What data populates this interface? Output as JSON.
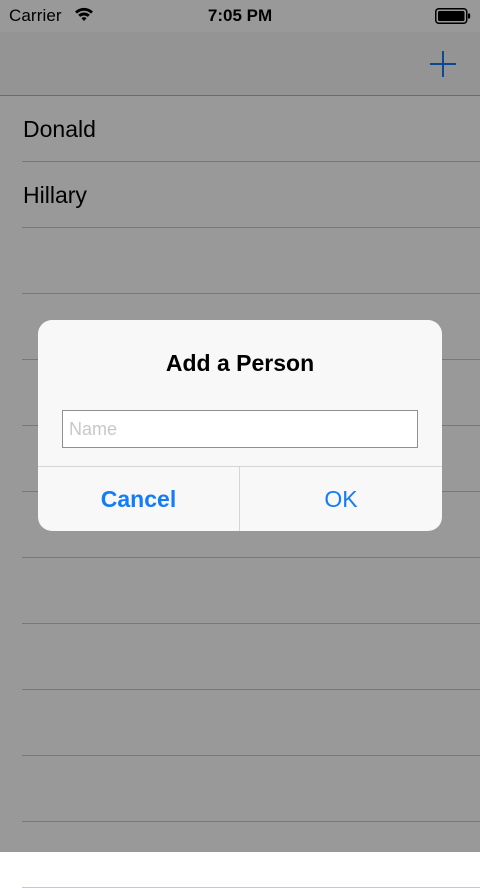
{
  "status_bar": {
    "carrier": "Carrier",
    "time": "7:05 PM",
    "wifi_icon": "wifi-icon",
    "battery_icon": "battery-icon"
  },
  "nav_bar": {
    "add_icon": "plus-icon"
  },
  "people": [
    {
      "name": "Donald"
    },
    {
      "name": "Hillary"
    }
  ],
  "alert": {
    "title": "Add a Person",
    "name_placeholder": "Name",
    "name_value": "",
    "cancel_label": "Cancel",
    "ok_label": "OK"
  },
  "colors": {
    "tint": "#137cf6",
    "overlay": "rgba(0,0,0,0.4)"
  }
}
